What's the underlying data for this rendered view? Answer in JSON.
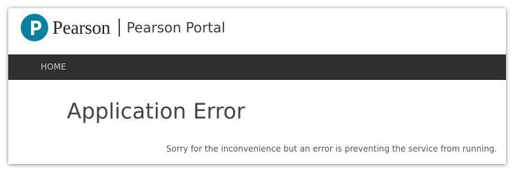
{
  "header": {
    "brand": "Pearson",
    "portal_title": "Pearson Portal",
    "logo_icon": "pearson-logo-icon",
    "logo_color": "#0a7f9e"
  },
  "nav": {
    "items": [
      {
        "label": "HOME"
      }
    ]
  },
  "main": {
    "title": "Application Error",
    "message": "Sorry for the inconvenience but an error is preventing the service from running."
  }
}
